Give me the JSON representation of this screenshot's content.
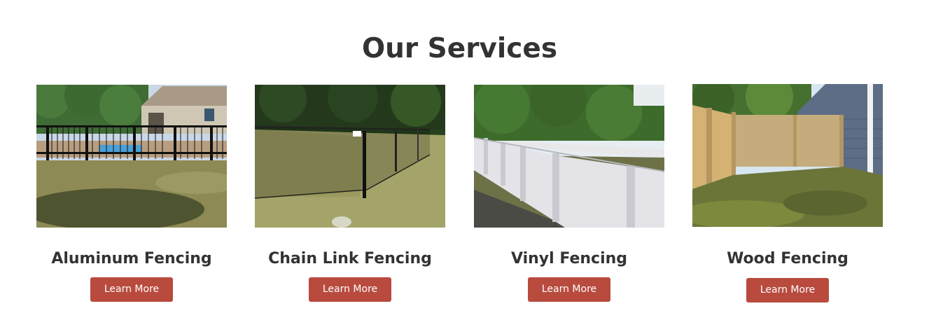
{
  "section": {
    "title": "Our Services"
  },
  "services": [
    {
      "title": "Aluminum Fencing",
      "button_label": "Learn More"
    },
    {
      "title": "Chain Link Fencing",
      "button_label": "Learn More"
    },
    {
      "title": "Vinyl Fencing",
      "button_label": "Learn More"
    },
    {
      "title": "Wood Fencing",
      "button_label": "Learn More"
    }
  ],
  "colors": {
    "button_background": "#b84a3e",
    "button_text": "#ffffff",
    "heading_text": "#333333"
  }
}
